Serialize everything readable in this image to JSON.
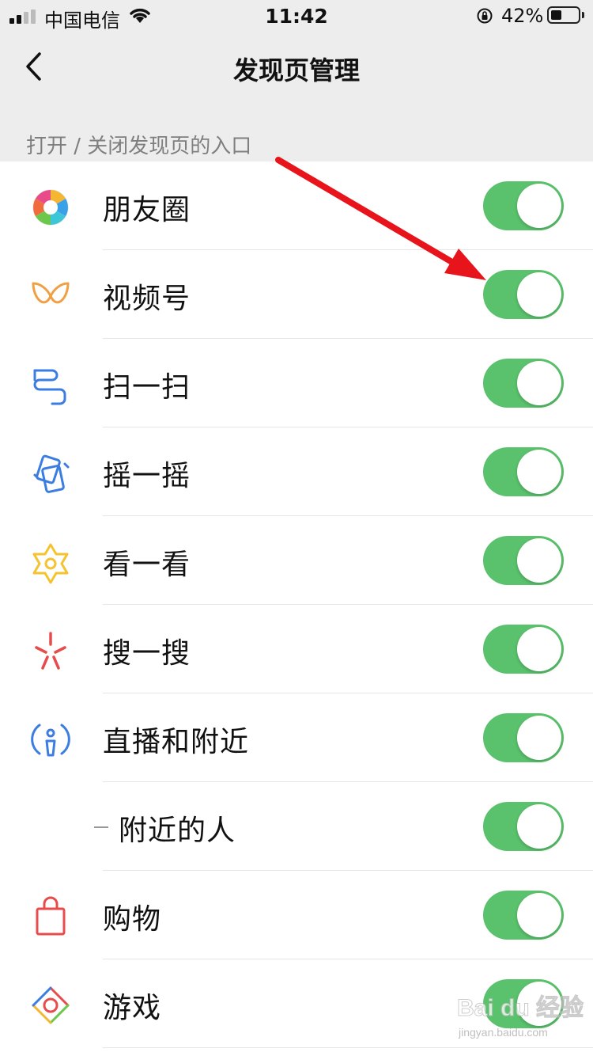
{
  "status_bar": {
    "carrier": "中国电信",
    "time": "11:42",
    "battery_percent": "42%",
    "battery_level": 0.42,
    "icons": [
      "signal-icon",
      "wifi-icon",
      "orientation-lock-icon",
      "battery-icon"
    ]
  },
  "nav": {
    "title": "发现页管理",
    "back_icon": "chevron-left-icon"
  },
  "section_header": "打开 / 关闭发现页的入口",
  "items": [
    {
      "label": "朋友圈",
      "icon": "moments-icon",
      "enabled": true
    },
    {
      "label": "视频号",
      "icon": "channels-icon",
      "enabled": true
    },
    {
      "label": "扫一扫",
      "icon": "scan-icon",
      "enabled": true
    },
    {
      "label": "摇一摇",
      "icon": "shake-icon",
      "enabled": true
    },
    {
      "label": "看一看",
      "icon": "top-stories-icon",
      "enabled": true
    },
    {
      "label": "搜一搜",
      "icon": "search-icon",
      "enabled": true
    },
    {
      "label": "直播和附近",
      "icon": "live-nearby-icon",
      "enabled": true
    },
    {
      "label": "附近的人",
      "icon": "",
      "enabled": true,
      "sub": true
    },
    {
      "label": "购物",
      "icon": "shopping-bag-icon",
      "enabled": true
    },
    {
      "label": "游戏",
      "icon": "games-icon",
      "enabled": true
    }
  ],
  "colors": {
    "toggle_on": "#5ac26c",
    "annotation_arrow": "#e8141b",
    "background": "#ededed"
  },
  "watermark": {
    "logo": "Bai du 经验",
    "url": "jingyan.baidu.com"
  }
}
